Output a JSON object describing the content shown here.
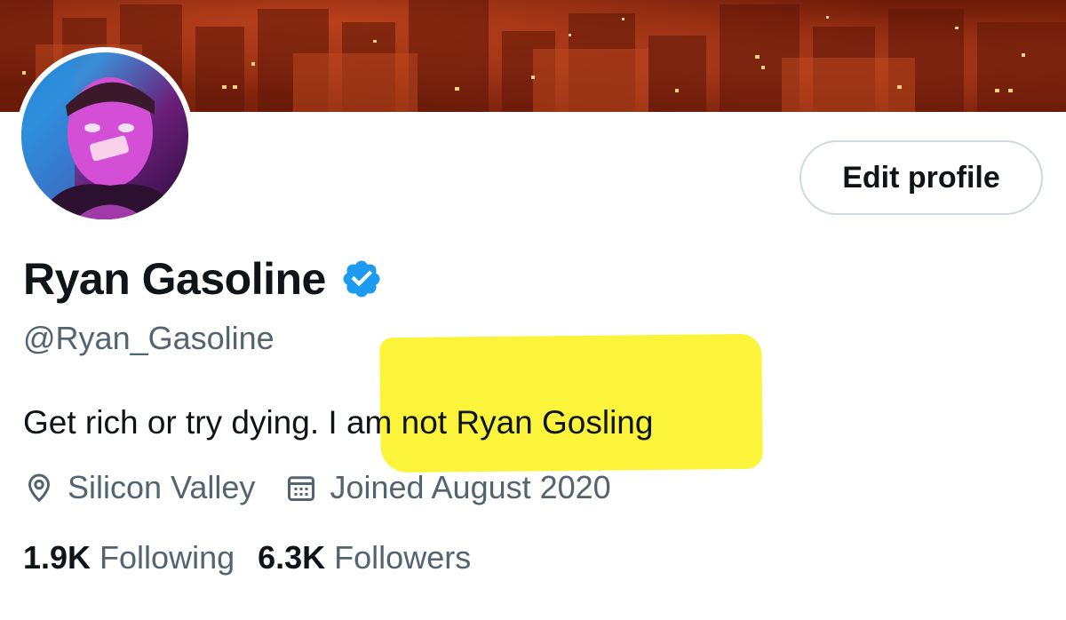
{
  "profile": {
    "display_name": "Ryan Gasoline",
    "handle": "@Ryan_Gasoline",
    "verified": true,
    "bio_plain": "Get rich or try dying. ",
    "bio_highlighted": "I am not Ryan Gosling",
    "location": "Silicon Valley",
    "joined": "Joined August 2020"
  },
  "actions": {
    "edit_profile_label": "Edit profile"
  },
  "stats": {
    "following_count": "1.9K",
    "following_label": "Following",
    "followers_count": "6.3K",
    "followers_label": "Followers"
  },
  "colors": {
    "verified_badge": "#1d9bf0",
    "text_primary": "#0f1419",
    "text_secondary": "#536471",
    "highlight": "#fbf43a",
    "button_border": "#cfd9de"
  },
  "icons": {
    "verified": "verified-badge-icon",
    "location": "location-pin-icon",
    "calendar": "calendar-icon"
  }
}
